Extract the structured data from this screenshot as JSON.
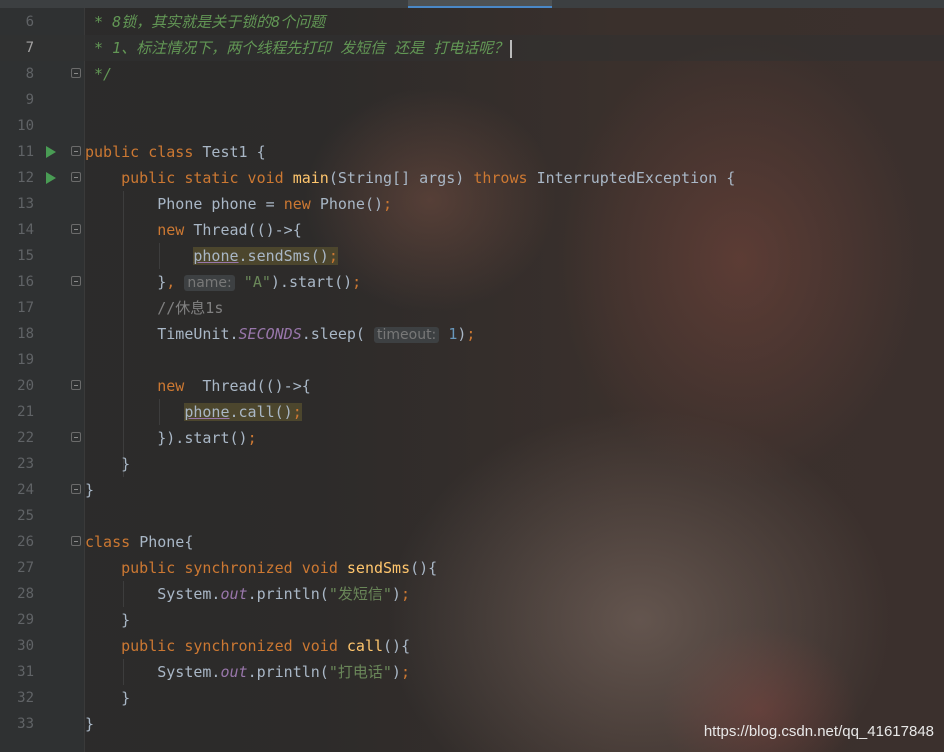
{
  "editor": {
    "current_line": 7,
    "lines": [
      {
        "n": "6",
        "text": " * 8锁，其实就是关于锁的8个问题"
      },
      {
        "n": "7",
        "text": " * 1、标注情况下，两个线程先打印 发短信 还是 打电话呢？"
      },
      {
        "n": "8",
        "text": " */"
      },
      {
        "n": "9",
        "text": ""
      },
      {
        "n": "10",
        "text": ""
      },
      {
        "n": "11",
        "text": "public class Test1 {"
      },
      {
        "n": "12",
        "text": "    public static void main(String[] args) throws InterruptedException {"
      },
      {
        "n": "13",
        "text": "        Phone phone = new Phone();"
      },
      {
        "n": "14",
        "text": "        new Thread(()->{"
      },
      {
        "n": "15",
        "text": "            phone.sendSms();"
      },
      {
        "n": "16",
        "text": "        }, name: \"A\").start();"
      },
      {
        "n": "17",
        "text": "        //休息1s"
      },
      {
        "n": "18",
        "text": "        TimeUnit.SECONDS.sleep( timeout: 1);"
      },
      {
        "n": "19",
        "text": ""
      },
      {
        "n": "20",
        "text": "        new  Thread(()->{"
      },
      {
        "n": "21",
        "text": "            phone.call();"
      },
      {
        "n": "22",
        "text": "        }).start();"
      },
      {
        "n": "23",
        "text": "    }"
      },
      {
        "n": "24",
        "text": "}"
      },
      {
        "n": "25",
        "text": ""
      },
      {
        "n": "26",
        "text": "class Phone{"
      },
      {
        "n": "27",
        "text": "    public synchronized void sendSms(){"
      },
      {
        "n": "28",
        "text": "        System.out.println(\"发短信\");"
      },
      {
        "n": "29",
        "text": "    }"
      },
      {
        "n": "30",
        "text": "    public synchronized void call(){"
      },
      {
        "n": "31",
        "text": "        System.out.println(\"打电话\");"
      },
      {
        "n": "32",
        "text": "    }"
      },
      {
        "n": "33",
        "text": "}"
      }
    ],
    "inlay_hints": {
      "thread_name": "name:",
      "sleep_timeout": "timeout:"
    }
  },
  "watermark": "https://blog.csdn.net/qq_41617848",
  "colors": {
    "background": "#2b2b2b",
    "keyword": "#cc7832",
    "method": "#ffc66d",
    "string": "#6a8759",
    "doc_comment": "#629755",
    "line_comment": "#808080",
    "static_field": "#9876aa",
    "number": "#6897bb",
    "run_icon": "#499c54"
  }
}
